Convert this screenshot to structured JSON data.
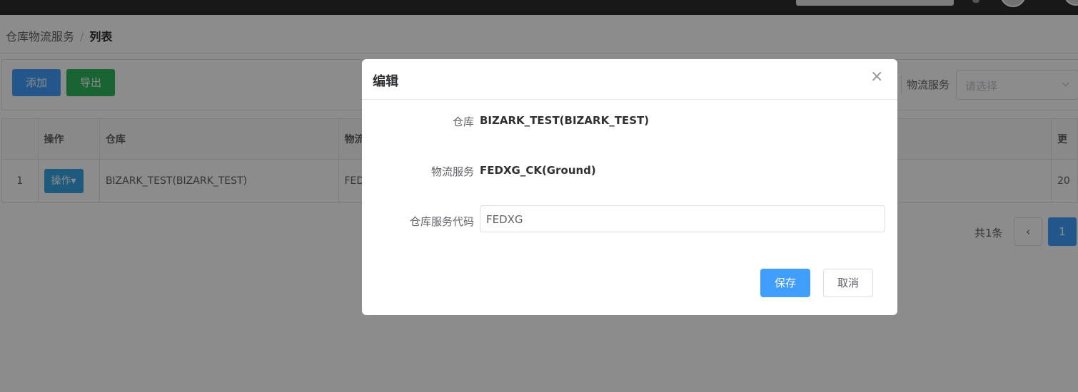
{
  "breadcrumb": {
    "parent": "仓库物流服务",
    "separator": "/",
    "current": "列表"
  },
  "toolbar": {
    "add_label": "添加",
    "export_label": "导出",
    "filter_label": "物流服务",
    "filter_placeholder": "请选择"
  },
  "table": {
    "headers": [
      "操作",
      "仓库",
      "物流",
      "更"
    ],
    "rows": [
      {
        "index": "1",
        "op_label": "操作▾",
        "warehouse": "BIZARK_TEST(BIZARK_TEST)",
        "logistics": "FED",
        "extra": "20"
      }
    ]
  },
  "pagination": {
    "total": "共1条",
    "prev": "‹",
    "current": "1"
  },
  "dialog": {
    "title": "编辑",
    "close_glyph": "×",
    "warehouse_label": "仓库",
    "warehouse_value": "BIZARK_TEST(BIZARK_TEST)",
    "service_label": "物流服务",
    "service_value": "FEDXG_CK(Ground)",
    "code_label": "仓库服务代码",
    "code_value": "FEDXG",
    "save_label": "保存",
    "cancel_label": "取消"
  },
  "colors": {
    "primary": "#409eff",
    "success": "#2fb65c",
    "overlay": "rgba(0,0,0,0.45)"
  },
  "icons": {
    "close": "close-icon",
    "dropdown": "chevron-down-icon",
    "prev": "chevron-left-icon"
  }
}
